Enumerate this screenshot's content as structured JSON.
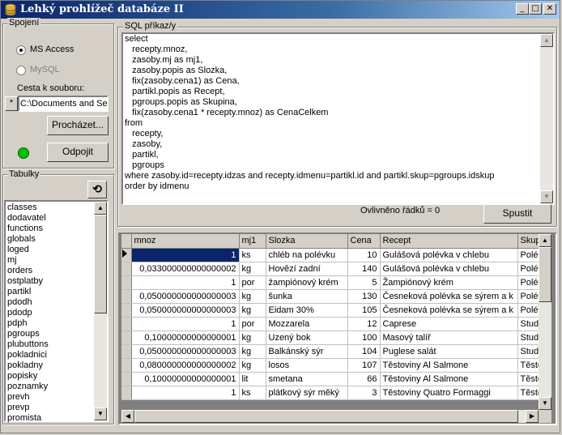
{
  "window": {
    "title": "Lehký prohlížeč databáze II",
    "min_label": "_",
    "max_label": "□",
    "close_label": "✕"
  },
  "connection": {
    "group_label": "Spojení",
    "options": [
      "MS Access",
      "MySQL"
    ],
    "selected": "MS Access",
    "path_label": "Cesta k souboru:",
    "path_prefix": "*",
    "path_value": "C:\\Documents and Set",
    "browse_label": "Procházet...",
    "disconnect_label": "Odpojit",
    "status_color": "#00c000"
  },
  "tables": {
    "group_label": "Tabulky",
    "refresh_icon": "refresh-icon",
    "items": [
      "classes",
      "dodavatel",
      "functions",
      "globals",
      "loged",
      "mj",
      "orders",
      "ostplatby",
      "partikl",
      "pdodh",
      "pdodp",
      "pdph",
      "pgroups",
      "plubuttons",
      "pokladnici",
      "pokladny",
      "popisky",
      "poznamky",
      "prevh",
      "prevp",
      "promista"
    ]
  },
  "sql": {
    "group_label": "SQL příkaz/y",
    "lines": [
      "select",
      "   recepty.mnoz,",
      "   zasoby.mj as mj1,",
      "   zasoby.popis as Slozka,",
      "   fix(zasoby.cena1) as Cena,",
      "   partikl.popis as Recept,",
      "   pgroups.popis as Skupina,",
      "   fix(zasoby.cena1 * recepty.mnoz) as CenaCelkem",
      "from",
      "   recepty,",
      "   zasoby,",
      "   partikl,",
      "   pgroups",
      "where zasoby.id=recepty.idzas and recepty.idmenu=partikl.id and partikl.skup=pgroups.idskup",
      "order by idmenu"
    ],
    "affected_label": "Ovlivněno řádků = 0",
    "run_label": "Spustit"
  },
  "grid": {
    "columns": [
      "mnoz",
      "mj1",
      "Slozka",
      "Cena",
      "Recept",
      "Skup"
    ],
    "rows": [
      [
        "1",
        "ks",
        "chléb na polévku",
        "10",
        "Gulášová polévka v chlebu",
        "Polév"
      ],
      [
        "0,033000000000000002",
        "kg",
        "Hovězí zadní",
        "140",
        "Gulášová polévka v chlebu",
        "Polév"
      ],
      [
        "1",
        "por",
        "žampiónový krém",
        "5",
        "Žampiónový krém",
        "Polév"
      ],
      [
        "0,050000000000000003",
        "kg",
        "šunka",
        "130",
        "Česneková polévka se sýrem a k",
        "Polév"
      ],
      [
        "0,050000000000000003",
        "kg",
        "Eidam 30%",
        "105",
        "Česneková polévka se sýrem a k",
        "Polév"
      ],
      [
        "1",
        "por",
        "Mozzarela",
        "12",
        "Caprese",
        "Stude"
      ],
      [
        "0,10000000000000001",
        "kg",
        "Uzený bok",
        "100",
        "Masový talíř",
        "Stude"
      ],
      [
        "0,050000000000000003",
        "kg",
        "Balkánský sýr",
        "104",
        "Puglese salát",
        "Stude"
      ],
      [
        "0,080000000000000002",
        "kg",
        "losos",
        "107",
        "Těstoviny Al Salmone",
        "Těsto"
      ],
      [
        "0,10000000000000001",
        "lit",
        "smetana",
        "66",
        "Těstoviny Al Salmone",
        "Těsto"
      ],
      [
        "1",
        "ks",
        "plátkový sýr měký",
        "3",
        "Těstoviny Quatro Formaggi",
        "Těsto"
      ]
    ]
  }
}
